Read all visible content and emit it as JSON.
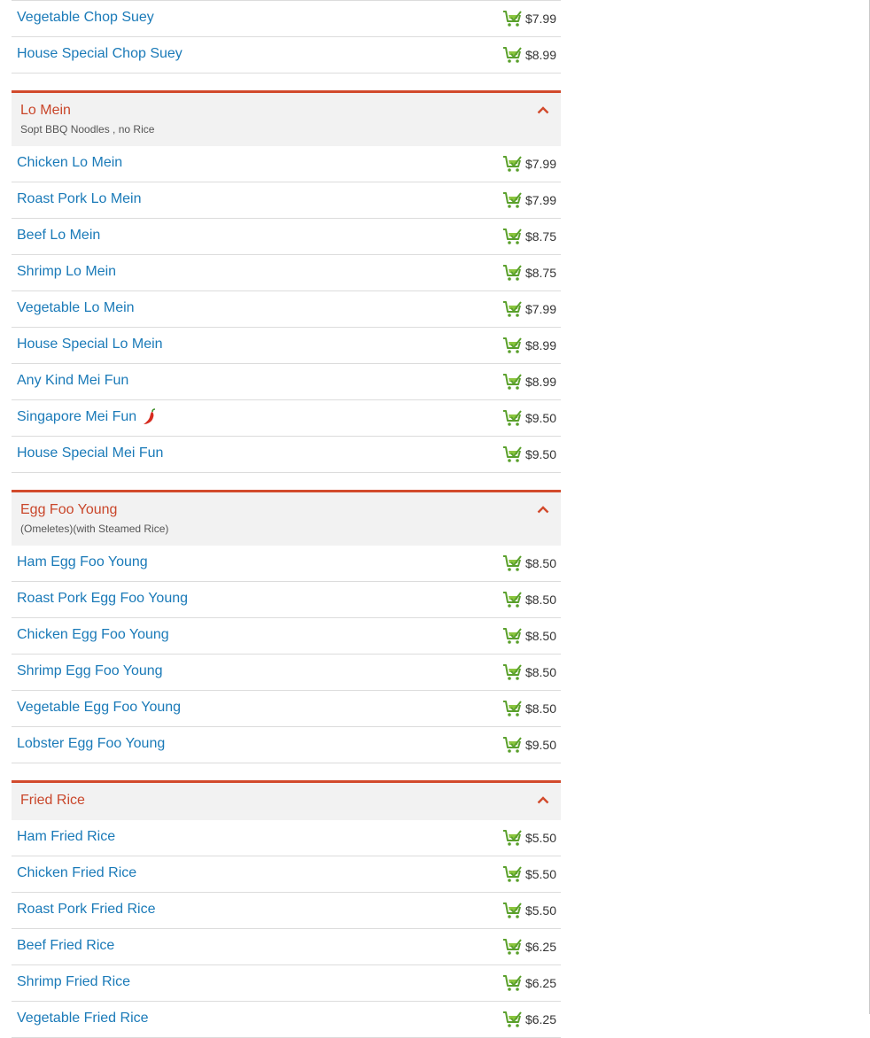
{
  "colors": {
    "accent": "#d24a2c",
    "item_link": "#1a7ab8",
    "cart_green": "#5aa02c",
    "header_bg": "#f2f2f2"
  },
  "icons": {
    "cart": "shopping-cart-add-icon",
    "collapse": "chevron-up-icon",
    "spicy": "chili-pepper-icon"
  },
  "chop_suey": {
    "items": [
      {
        "name": "Vegetable Chop Suey",
        "price": "$7.99"
      },
      {
        "name": "House Special Chop Suey",
        "price": "$8.99"
      }
    ]
  },
  "lo_mein": {
    "title": "Lo Mein",
    "description": "Sopt BBQ Noodles , no Rice",
    "items": [
      {
        "name": "Chicken Lo Mein",
        "price": "$7.99"
      },
      {
        "name": "Roast Pork Lo Mein",
        "price": "$7.99"
      },
      {
        "name": "Beef Lo Mein",
        "price": "$8.75"
      },
      {
        "name": "Shrimp Lo Mein",
        "price": "$8.75"
      },
      {
        "name": "Vegetable Lo Mein",
        "price": "$7.99"
      },
      {
        "name": "House Special Lo Mein",
        "price": "$8.99"
      },
      {
        "name": "Any Kind Mei Fun",
        "price": "$8.99"
      },
      {
        "name": "Singapore Mei Fun",
        "price": "$9.50",
        "spicy": true
      },
      {
        "name": "House Special Mei Fun",
        "price": "$9.50"
      }
    ]
  },
  "egg_foo_young": {
    "title": "Egg Foo Young",
    "description": "(Omeletes)(with Steamed Rice)",
    "items": [
      {
        "name": "Ham Egg Foo Young",
        "price": "$8.50"
      },
      {
        "name": "Roast Pork Egg Foo Young",
        "price": "$8.50"
      },
      {
        "name": "Chicken Egg Foo Young",
        "price": "$8.50"
      },
      {
        "name": "Shrimp Egg Foo Young",
        "price": "$8.50"
      },
      {
        "name": "Vegetable Egg Foo Young",
        "price": "$8.50"
      },
      {
        "name": "Lobster Egg Foo Young",
        "price": "$9.50"
      }
    ]
  },
  "fried_rice": {
    "title": "Fried Rice",
    "items": [
      {
        "name": "Ham Fried Rice",
        "price": "$5.50"
      },
      {
        "name": "Chicken Fried Rice",
        "price": "$5.50"
      },
      {
        "name": "Roast Pork Fried Rice",
        "price": "$5.50"
      },
      {
        "name": "Beef Fried Rice",
        "price": "$6.25"
      },
      {
        "name": "Shrimp Fried Rice",
        "price": "$6.25"
      },
      {
        "name": "Vegetable Fried Rice",
        "price": "$6.25"
      }
    ]
  }
}
